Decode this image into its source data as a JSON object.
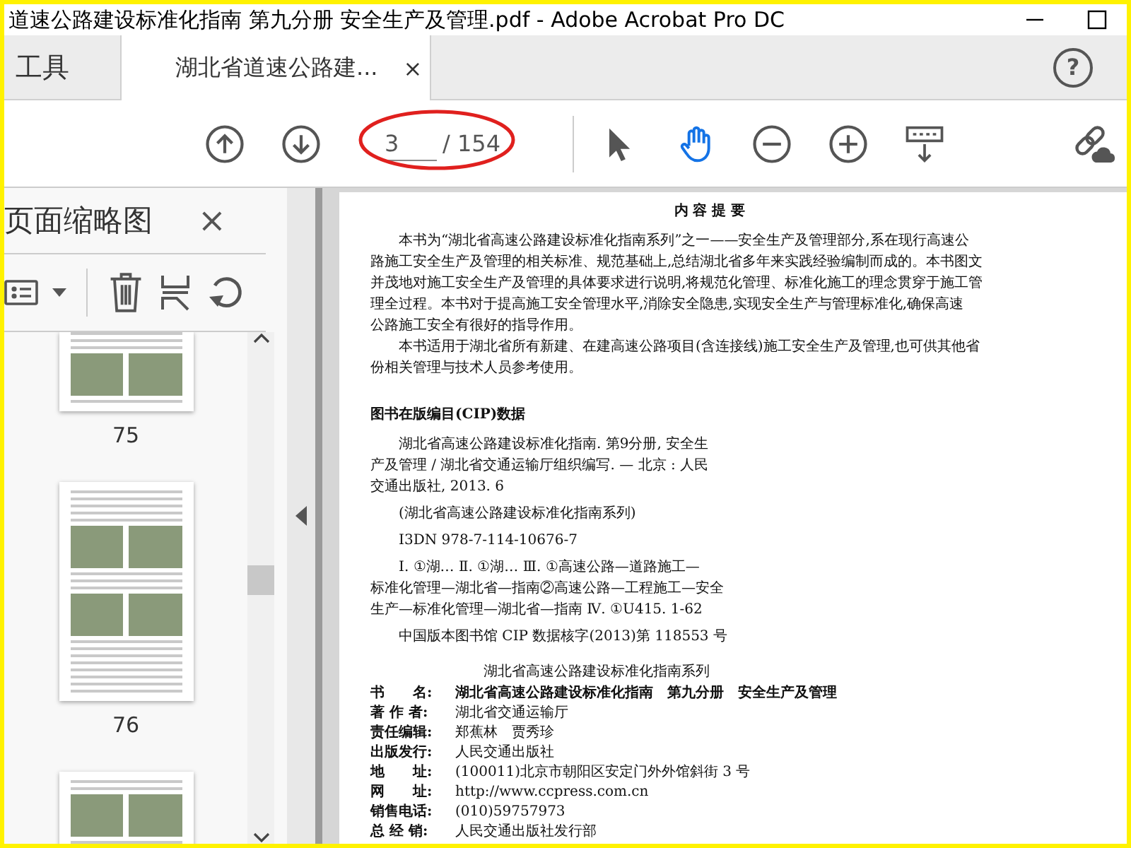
{
  "window": {
    "title": "道速公路建设标准化指南 第九分册 安全生产及管理.pdf - Adobe Acrobat Pro DC"
  },
  "tabs": [
    {
      "kind": "home",
      "label": "工具",
      "selected": false
    },
    {
      "kind": "document",
      "label": "湖北省道速公路建...",
      "selected": true,
      "close": "×"
    }
  ],
  "help": "?",
  "toolbar": {
    "page_value": "3",
    "page_total": "/ 154",
    "tools": [
      {
        "kind": "select",
        "selected": false
      },
      {
        "kind": "hand",
        "selected": true
      },
      {
        "kind": "zoom-out",
        "selected": false
      },
      {
        "kind": "zoom-in",
        "selected": false
      },
      {
        "kind": "read-mode",
        "selected": false
      }
    ]
  },
  "sidebar": {
    "title": "页面缩略图",
    "close": "×",
    "thumbnails": [
      {
        "kind": "partial",
        "label": "75"
      },
      {
        "kind": "full",
        "label": "76"
      },
      {
        "kind": "cut"
      }
    ]
  },
  "document": {
    "heading": "内 容 提 要",
    "paragraphs": [
      {
        "lines": [
          "本书为“湖北省高速公路建设标准化指南系列”之一——安全生产及管理部分,系在现行高速公",
          "路施工安全生产及管理的相关标准、规范基础上,总结湖北省多年来实践经验编制而成的。本书图文",
          "并茂地对施工安全生产及管理的具体要求进行说明,将规范化管理、标准化施工的理念贯穿于施工管",
          "理全过程。本书对于提高施工安全管理水平,消除安全隐患,实现安全生产与管理标准化,确保高速",
          "公路施工安全有很好的指导作用。"
        ]
      },
      {
        "lines": [
          "本书适用于湖北省所有新建、在建高速公路项目(含连接线)施工安全生产及管理,也可供其他省",
          "份相关管理与技术人员参考使用。"
        ]
      }
    ],
    "cip_title": "图书在版编目(CIP)数据",
    "cip_blocks": [
      {
        "lines": [
          "湖北省高速公路建设标准化指南. 第9分册, 安全生",
          "产及管理 / 湖北省交通运输厅组织编写. — 北京 : 人民",
          "交通出版社, 2013. 6"
        ]
      },
      {
        "lines": [
          "(湖北省高速公路建设标准化指南系列)"
        ]
      },
      {
        "lines": [
          "I3DN 978-7-114-10676-7"
        ]
      },
      {
        "lines": [
          "Ⅰ. ①湖…  Ⅱ. ①湖…  Ⅲ. ①高速公路—道路施工—",
          "标准化管理—湖北省—指南②高速公路—工程施工—安全",
          "生产—标准化管理—湖北省—指南  Ⅳ. ①U415. 1-62"
        ]
      },
      {
        "lines": [
          "中国版本图书馆 CIP 数据核字(2013)第 118553 号"
        ]
      }
    ],
    "series_title": "湖北省高速公路建设标准化指南系列",
    "info_rows": [
      {
        "label": "书　　名:",
        "value": "湖北省高速公路建设标准化指南　第九分册　安全生产及管理"
      },
      {
        "label": "著 作 者:",
        "value": "湖北省交通运输厅"
      },
      {
        "label": "责任编辑:",
        "value": "郑蕉林　贾秀珍"
      },
      {
        "label": "出版发行:",
        "value": "人民交通出版社"
      },
      {
        "label": "地　　址:",
        "value": "(100011)北京市朝阳区安定门外外馆斜街 3 号"
      },
      {
        "label": "网　　址:",
        "value": "http://www.ccpress.com.cn"
      },
      {
        "label": "销售电话:",
        "value": "(010)59757973"
      },
      {
        "label": "总 经 销:",
        "value": "人民交通出版社发行部"
      }
    ]
  }
}
